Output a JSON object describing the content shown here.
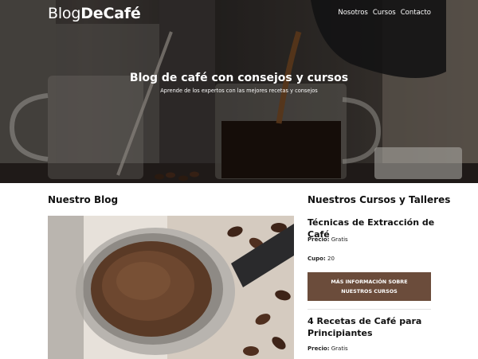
{
  "header": {
    "logo_part1": "Blog",
    "logo_part2": "DeCafé",
    "nav": [
      {
        "label": "Nosotros"
      },
      {
        "label": "Cursos"
      },
      {
        "label": "Contacto"
      }
    ]
  },
  "hero": {
    "title": "Blog de café con consejos y cursos",
    "subtitle": "Aprende de los expertos con las mejores recetas y consejos"
  },
  "blog": {
    "heading": "Nuestro Blog"
  },
  "courses": {
    "heading": "Nuestros Cursos y Talleres",
    "items": [
      {
        "title": "Técnicas de Extracción de Café",
        "price_label": "Precio:",
        "price_value": "Gratis",
        "cupo_label": "Cupo:",
        "cupo_value": "20",
        "button_label": "Más información sobre nuestros cursos"
      },
      {
        "title": "4 Recetas de Café para Principiantes",
        "price_label": "Precio:",
        "price_value": "Gratis"
      }
    ]
  },
  "colors": {
    "button_bg": "#6b4c3b",
    "hero_overlay": "#000000"
  }
}
